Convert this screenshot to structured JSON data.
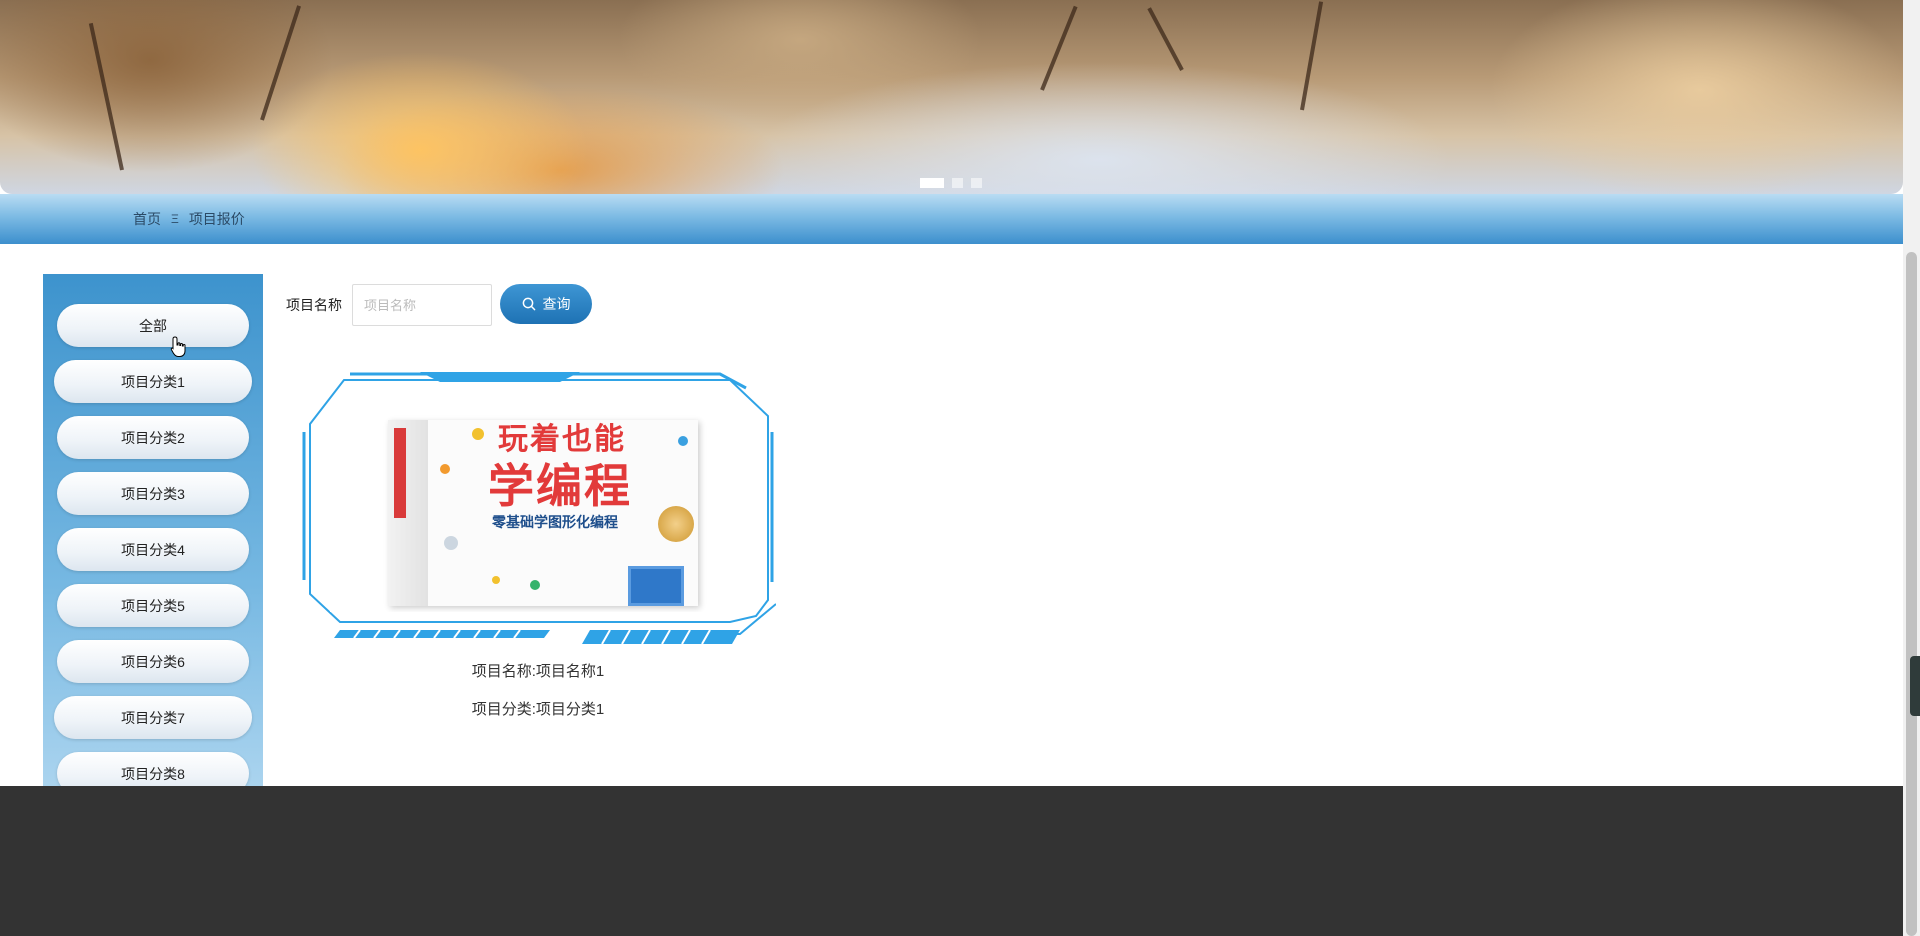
{
  "banner": {
    "dots": [
      {
        "name": "banner-dot-1",
        "active": true
      },
      {
        "name": "banner-dot-2",
        "active": false
      },
      {
        "name": "banner-dot-3",
        "active": false
      }
    ]
  },
  "breadcrumb": {
    "home": "首页",
    "separator": "Ξ",
    "current": "项目报价"
  },
  "sidebar": {
    "items": [
      {
        "label": "全部"
      },
      {
        "label": "项目分类1"
      },
      {
        "label": "项目分类2"
      },
      {
        "label": "项目分类3"
      },
      {
        "label": "项目分类4"
      },
      {
        "label": "项目分类5"
      },
      {
        "label": "项目分类6"
      },
      {
        "label": "项目分类7"
      },
      {
        "label": "项目分类8"
      }
    ]
  },
  "search": {
    "label": "项目名称",
    "placeholder": "项目名称",
    "value": "",
    "button_label": "查询",
    "button_icon": "search-icon"
  },
  "cards": [
    {
      "image_text": {
        "title_top": "玩着也能",
        "title_main": "学编程",
        "subtitle": "零基础学图形化编程"
      },
      "name_line": "项目名称:项目名称1",
      "category_line": "项目分类:项目分类1"
    }
  ],
  "colors": {
    "accent": "#1e72b4",
    "sidebar_top": "#3d93cd",
    "footer": "#333333",
    "frame": "#2fa3e6"
  }
}
